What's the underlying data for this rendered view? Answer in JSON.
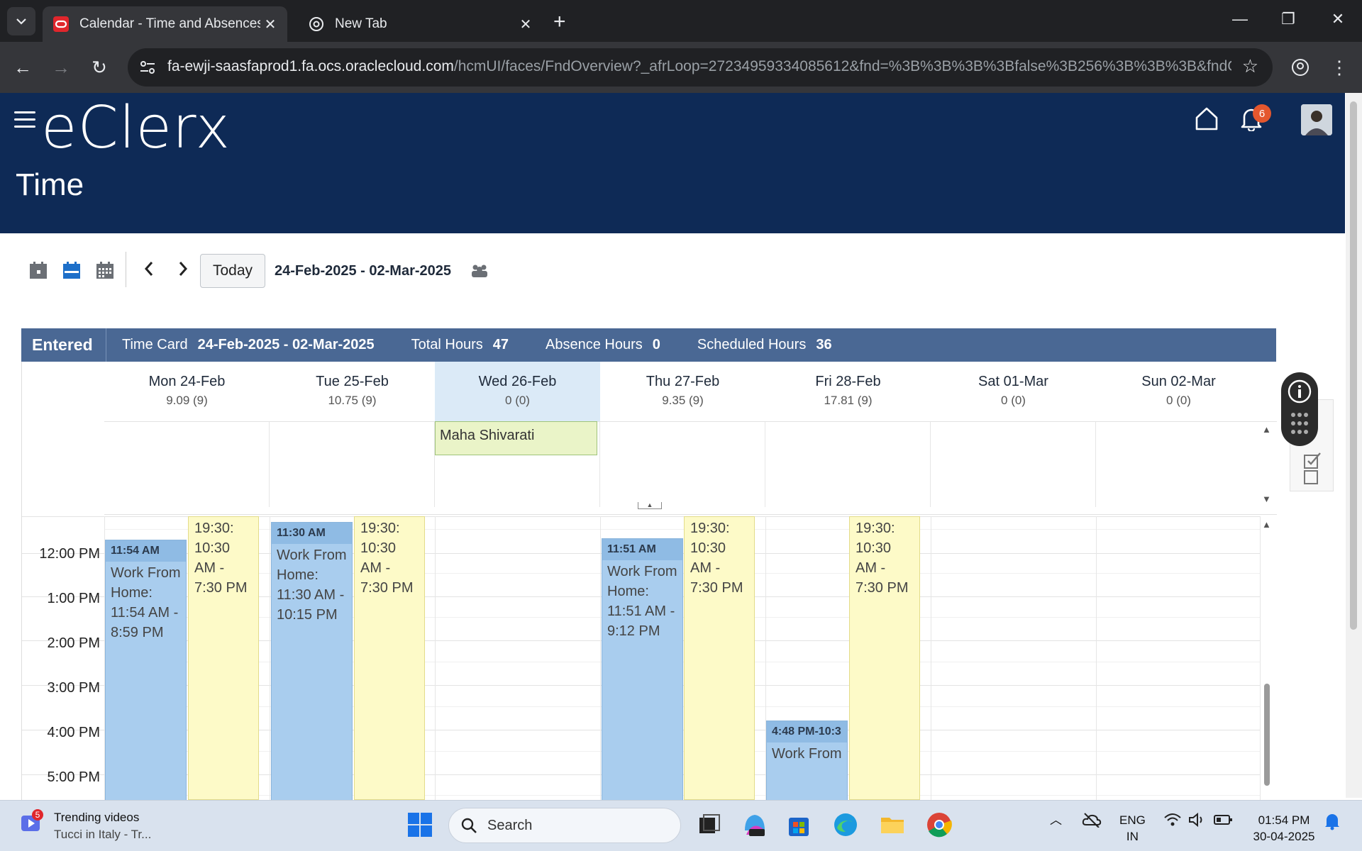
{
  "browser": {
    "active_tab_title": "Calendar - Time and Absences",
    "inactive_tab_title": "New Tab",
    "url_host": "fa-ewji-saasfaprod1.fa.ocs.oraclecloud.com",
    "url_path": "/hcmUI/faces/FndOverview?_afrLoop=27234959334085612&fnd=%3B%3B%3B%3Bfalse%3B256%3B%3B%3B&fndGl..."
  },
  "header": {
    "logo": "eClerx",
    "page_title": "Time",
    "notification_count": "6"
  },
  "toolbar": {
    "today_label": "Today",
    "date_range": "24-Feb-2025 - 02-Mar-2025"
  },
  "summary": {
    "status": "Entered",
    "time_card_label": "Time Card",
    "time_card_value": "24-Feb-2025 - 02-Mar-2025",
    "total_hours_label": "Total Hours",
    "total_hours_value": "47",
    "absence_hours_label": "Absence Hours",
    "absence_hours_value": "0",
    "scheduled_hours_label": "Scheduled Hours",
    "scheduled_hours_value": "36"
  },
  "days": [
    {
      "label": "Mon 24-Feb",
      "hours": "9.09 (9)"
    },
    {
      "label": "Tue 25-Feb",
      "hours": "10.75 (9)"
    },
    {
      "label": "Wed 26-Feb",
      "hours": "0 (0)"
    },
    {
      "label": "Thu 27-Feb",
      "hours": "9.35 (9)"
    },
    {
      "label": "Fri 28-Feb",
      "hours": "17.81 (9)"
    },
    {
      "label": "Sat 01-Mar",
      "hours": "0 (0)"
    },
    {
      "label": "Sun 02-Mar",
      "hours": "0 (0)"
    }
  ],
  "holiday": "Maha Shivarati",
  "time_labels": [
    "12:00 PM",
    "1:00 PM",
    "2:00 PM",
    "3:00 PM",
    "4:00 PM",
    "5:00 PM"
  ],
  "events": {
    "mon_wfh_header": "11:54 AM",
    "mon_wfh_body": "Work From Home: 11:54 AM - 8:59 PM",
    "mon_sched": "19:30: 10:30 AM - 7:30 PM",
    "tue_wfh_header": "11:30 AM",
    "tue_wfh_body": "Work From Home: 11:30 AM - 10:15 PM",
    "tue_sched": "19:30: 10:30 AM - 7:30 PM",
    "thu_wfh_header": "11:51 AM",
    "thu_wfh_body": "Work From Home: 11:51 AM - 9:12 PM",
    "thu_sched": "19:30: 10:30 AM - 7:30 PM",
    "fri_wfh_header": "4:48 PM-10:3",
    "fri_wfh_body": "Work From",
    "fri_sched": "19:30: 10:30 AM - 7:30 PM"
  },
  "taskbar": {
    "widget_title": "Trending videos",
    "widget_sub": "Tucci in Italy - Tr...",
    "widget_badge": "5",
    "search_placeholder": "Search",
    "lang_top": "ENG",
    "lang_bottom": "IN",
    "time": "01:54 PM",
    "date": "30-04-2025"
  },
  "colors": {
    "header_bg": "#0e2a56",
    "summary_bg": "#4a6894",
    "wfh_event": "#a9cdee",
    "scheduled_event": "#fdfac8",
    "holiday": "#eaf4c8",
    "today_column": "#dbeaf7"
  }
}
